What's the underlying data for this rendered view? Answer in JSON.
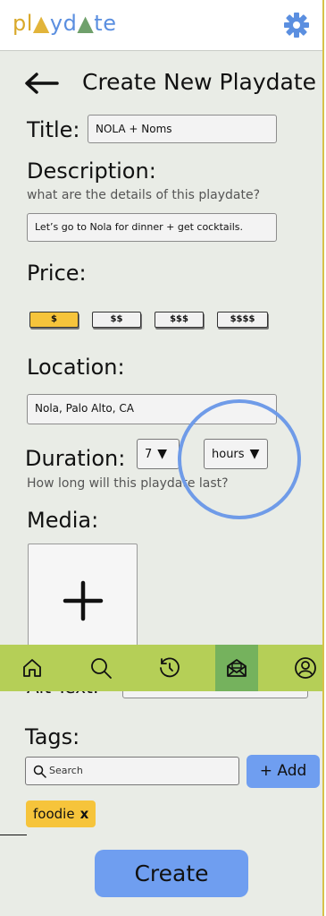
{
  "app": {
    "logo_letters": [
      "p",
      "l",
      "▲",
      "y",
      "d",
      "▲",
      "t",
      "e"
    ],
    "colors": {
      "accent_yellow": "#f6c43b",
      "accent_blue": "#6f9ef0",
      "nav_green": "#b5cf57",
      "nav_active": "#75b25d"
    }
  },
  "header": {
    "title": "Create New Playdate",
    "back_icon": "arrow-left-icon",
    "settings_icon": "gear-icon"
  },
  "form": {
    "title_label": "Title:",
    "title_value": "NOLA + Noms",
    "description_label": "Description:",
    "description_hint": "what are the details of this playdate?",
    "description_value": "Let’s go to Nola for dinner + get cocktails.",
    "price_label": "Price:",
    "price_options": [
      "$",
      "$$",
      "$$$",
      "$$$$"
    ],
    "price_selected": "$",
    "location_label": "Location:",
    "location_value": "Nola, Palo Alto, CA",
    "duration_label": "Duration:",
    "duration_value": "7",
    "duration_unit": "hours",
    "duration_hint": "How long will this playdate last?",
    "media_label": "Media:",
    "alt_text_label": "Alt Text:",
    "tags_label": "Tags:",
    "search_placeholder": "Search",
    "add_label": "+ Add",
    "tags": [
      "foodie"
    ],
    "tag_remove": "x",
    "create_label": "Create"
  },
  "nav": {
    "items": [
      {
        "icon": "home-icon"
      },
      {
        "icon": "search-icon"
      },
      {
        "icon": "history-icon"
      },
      {
        "icon": "envelope-icon",
        "active": true
      },
      {
        "icon": "profile-icon"
      }
    ]
  }
}
